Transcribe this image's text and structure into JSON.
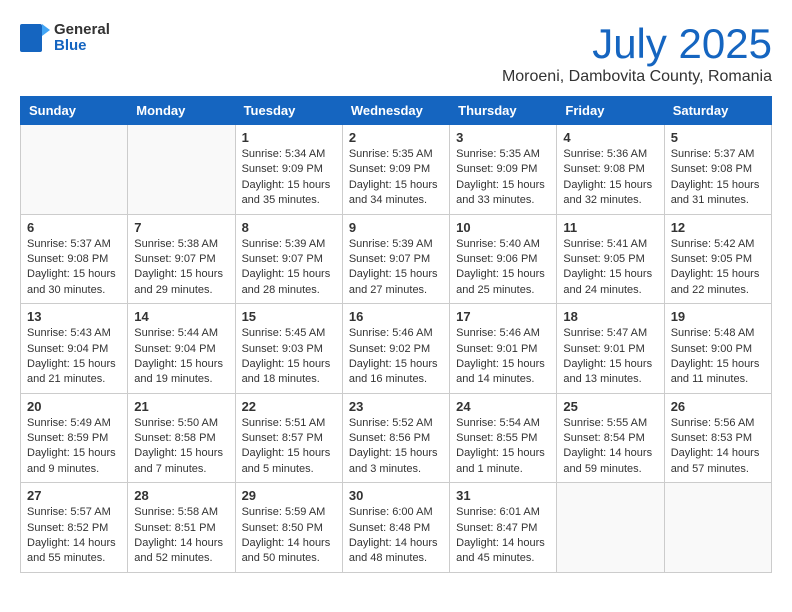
{
  "header": {
    "logo_general": "General",
    "logo_blue": "Blue",
    "month_year": "July 2025",
    "location": "Moroeni, Dambovita County, Romania"
  },
  "days_of_week": [
    "Sunday",
    "Monday",
    "Tuesday",
    "Wednesday",
    "Thursday",
    "Friday",
    "Saturday"
  ],
  "weeks": [
    [
      {
        "day": "",
        "sunrise": "",
        "sunset": "",
        "daylight": ""
      },
      {
        "day": "",
        "sunrise": "",
        "sunset": "",
        "daylight": ""
      },
      {
        "day": "1",
        "sunrise": "Sunrise: 5:34 AM",
        "sunset": "Sunset: 9:09 PM",
        "daylight": "Daylight: 15 hours and 35 minutes."
      },
      {
        "day": "2",
        "sunrise": "Sunrise: 5:35 AM",
        "sunset": "Sunset: 9:09 PM",
        "daylight": "Daylight: 15 hours and 34 minutes."
      },
      {
        "day": "3",
        "sunrise": "Sunrise: 5:35 AM",
        "sunset": "Sunset: 9:09 PM",
        "daylight": "Daylight: 15 hours and 33 minutes."
      },
      {
        "day": "4",
        "sunrise": "Sunrise: 5:36 AM",
        "sunset": "Sunset: 9:08 PM",
        "daylight": "Daylight: 15 hours and 32 minutes."
      },
      {
        "day": "5",
        "sunrise": "Sunrise: 5:37 AM",
        "sunset": "Sunset: 9:08 PM",
        "daylight": "Daylight: 15 hours and 31 minutes."
      }
    ],
    [
      {
        "day": "6",
        "sunrise": "Sunrise: 5:37 AM",
        "sunset": "Sunset: 9:08 PM",
        "daylight": "Daylight: 15 hours and 30 minutes."
      },
      {
        "day": "7",
        "sunrise": "Sunrise: 5:38 AM",
        "sunset": "Sunset: 9:07 PM",
        "daylight": "Daylight: 15 hours and 29 minutes."
      },
      {
        "day": "8",
        "sunrise": "Sunrise: 5:39 AM",
        "sunset": "Sunset: 9:07 PM",
        "daylight": "Daylight: 15 hours and 28 minutes."
      },
      {
        "day": "9",
        "sunrise": "Sunrise: 5:39 AM",
        "sunset": "Sunset: 9:07 PM",
        "daylight": "Daylight: 15 hours and 27 minutes."
      },
      {
        "day": "10",
        "sunrise": "Sunrise: 5:40 AM",
        "sunset": "Sunset: 9:06 PM",
        "daylight": "Daylight: 15 hours and 25 minutes."
      },
      {
        "day": "11",
        "sunrise": "Sunrise: 5:41 AM",
        "sunset": "Sunset: 9:05 PM",
        "daylight": "Daylight: 15 hours and 24 minutes."
      },
      {
        "day": "12",
        "sunrise": "Sunrise: 5:42 AM",
        "sunset": "Sunset: 9:05 PM",
        "daylight": "Daylight: 15 hours and 22 minutes."
      }
    ],
    [
      {
        "day": "13",
        "sunrise": "Sunrise: 5:43 AM",
        "sunset": "Sunset: 9:04 PM",
        "daylight": "Daylight: 15 hours and 21 minutes."
      },
      {
        "day": "14",
        "sunrise": "Sunrise: 5:44 AM",
        "sunset": "Sunset: 9:04 PM",
        "daylight": "Daylight: 15 hours and 19 minutes."
      },
      {
        "day": "15",
        "sunrise": "Sunrise: 5:45 AM",
        "sunset": "Sunset: 9:03 PM",
        "daylight": "Daylight: 15 hours and 18 minutes."
      },
      {
        "day": "16",
        "sunrise": "Sunrise: 5:46 AM",
        "sunset": "Sunset: 9:02 PM",
        "daylight": "Daylight: 15 hours and 16 minutes."
      },
      {
        "day": "17",
        "sunrise": "Sunrise: 5:46 AM",
        "sunset": "Sunset: 9:01 PM",
        "daylight": "Daylight: 15 hours and 14 minutes."
      },
      {
        "day": "18",
        "sunrise": "Sunrise: 5:47 AM",
        "sunset": "Sunset: 9:01 PM",
        "daylight": "Daylight: 15 hours and 13 minutes."
      },
      {
        "day": "19",
        "sunrise": "Sunrise: 5:48 AM",
        "sunset": "Sunset: 9:00 PM",
        "daylight": "Daylight: 15 hours and 11 minutes."
      }
    ],
    [
      {
        "day": "20",
        "sunrise": "Sunrise: 5:49 AM",
        "sunset": "Sunset: 8:59 PM",
        "daylight": "Daylight: 15 hours and 9 minutes."
      },
      {
        "day": "21",
        "sunrise": "Sunrise: 5:50 AM",
        "sunset": "Sunset: 8:58 PM",
        "daylight": "Daylight: 15 hours and 7 minutes."
      },
      {
        "day": "22",
        "sunrise": "Sunrise: 5:51 AM",
        "sunset": "Sunset: 8:57 PM",
        "daylight": "Daylight: 15 hours and 5 minutes."
      },
      {
        "day": "23",
        "sunrise": "Sunrise: 5:52 AM",
        "sunset": "Sunset: 8:56 PM",
        "daylight": "Daylight: 15 hours and 3 minutes."
      },
      {
        "day": "24",
        "sunrise": "Sunrise: 5:54 AM",
        "sunset": "Sunset: 8:55 PM",
        "daylight": "Daylight: 15 hours and 1 minute."
      },
      {
        "day": "25",
        "sunrise": "Sunrise: 5:55 AM",
        "sunset": "Sunset: 8:54 PM",
        "daylight": "Daylight: 14 hours and 59 minutes."
      },
      {
        "day": "26",
        "sunrise": "Sunrise: 5:56 AM",
        "sunset": "Sunset: 8:53 PM",
        "daylight": "Daylight: 14 hours and 57 minutes."
      }
    ],
    [
      {
        "day": "27",
        "sunrise": "Sunrise: 5:57 AM",
        "sunset": "Sunset: 8:52 PM",
        "daylight": "Daylight: 14 hours and 55 minutes."
      },
      {
        "day": "28",
        "sunrise": "Sunrise: 5:58 AM",
        "sunset": "Sunset: 8:51 PM",
        "daylight": "Daylight: 14 hours and 52 minutes."
      },
      {
        "day": "29",
        "sunrise": "Sunrise: 5:59 AM",
        "sunset": "Sunset: 8:50 PM",
        "daylight": "Daylight: 14 hours and 50 minutes."
      },
      {
        "day": "30",
        "sunrise": "Sunrise: 6:00 AM",
        "sunset": "Sunset: 8:48 PM",
        "daylight": "Daylight: 14 hours and 48 minutes."
      },
      {
        "day": "31",
        "sunrise": "Sunrise: 6:01 AM",
        "sunset": "Sunset: 8:47 PM",
        "daylight": "Daylight: 14 hours and 45 minutes."
      },
      {
        "day": "",
        "sunrise": "",
        "sunset": "",
        "daylight": ""
      },
      {
        "day": "",
        "sunrise": "",
        "sunset": "",
        "daylight": ""
      }
    ]
  ]
}
